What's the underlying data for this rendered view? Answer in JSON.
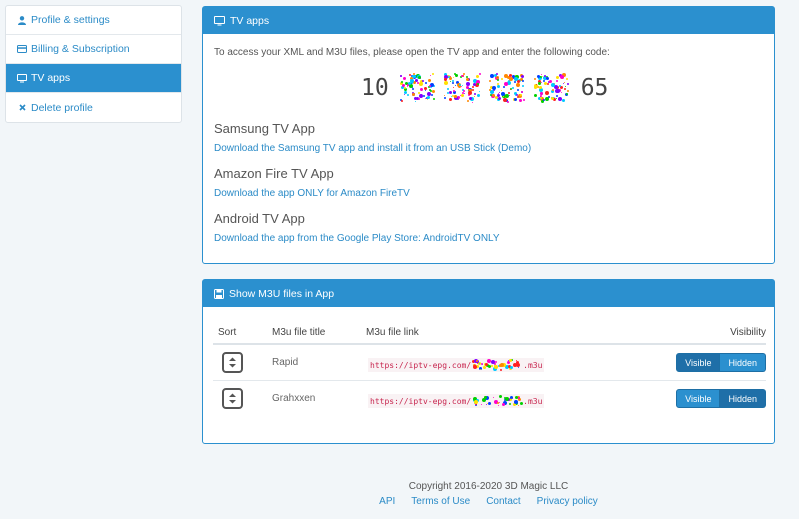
{
  "sidebar": {
    "items": [
      {
        "label": "Profile & settings",
        "icon": "user-icon",
        "active": false
      },
      {
        "label": "Billing & Subscription",
        "icon": "credit-card-icon",
        "active": false
      },
      {
        "label": "TV apps",
        "icon": "monitor-icon",
        "active": true
      },
      {
        "label": "Delete profile",
        "icon": "close-icon",
        "active": false
      }
    ]
  },
  "tv_panel": {
    "title": "TV apps",
    "intro": "To access your XML and M3U files, please open the TV app and enter the following code:",
    "code_start": "10",
    "code_end": "65",
    "samsung": {
      "title": "Samsung TV App",
      "link": "Download the Samsung TV app and install it from an USB Stick (Demo)"
    },
    "amazon": {
      "title": "Amazon Fire TV App",
      "link": "Download the app ONLY for Amazon FireTV"
    },
    "android": {
      "title": "Android TV App",
      "link": "Download the app from the Google Play Store: AndroidTV ONLY"
    }
  },
  "m3u_panel": {
    "title": "Show M3U files in App",
    "columns": {
      "sort": "Sort",
      "title": "M3u file title",
      "link": "M3u file link",
      "visibility": "Visibility"
    },
    "rows": [
      {
        "title": "Rapid",
        "link_prefix": "https://iptv-epg.com/",
        "link_suffix": ".m3u",
        "visible_label": "Visible",
        "hidden_label": "Hidden",
        "selected": "Visible"
      },
      {
        "title": "Grahxxen",
        "link_prefix": "https://iptv-epg.com/",
        "link_suffix": ".m3u",
        "visible_label": "Visible",
        "hidden_label": "Hidden",
        "selected": "Hidden"
      }
    ]
  },
  "footer": {
    "copyright": "Copyright 2016-2020 3D Magic LLC",
    "links": [
      "API",
      "Terms of Use",
      "Contact",
      "Privacy policy"
    ]
  },
  "colors": {
    "accent": "#2b90cf",
    "link": "#2b8bc7",
    "code_red": "#c7254e"
  }
}
